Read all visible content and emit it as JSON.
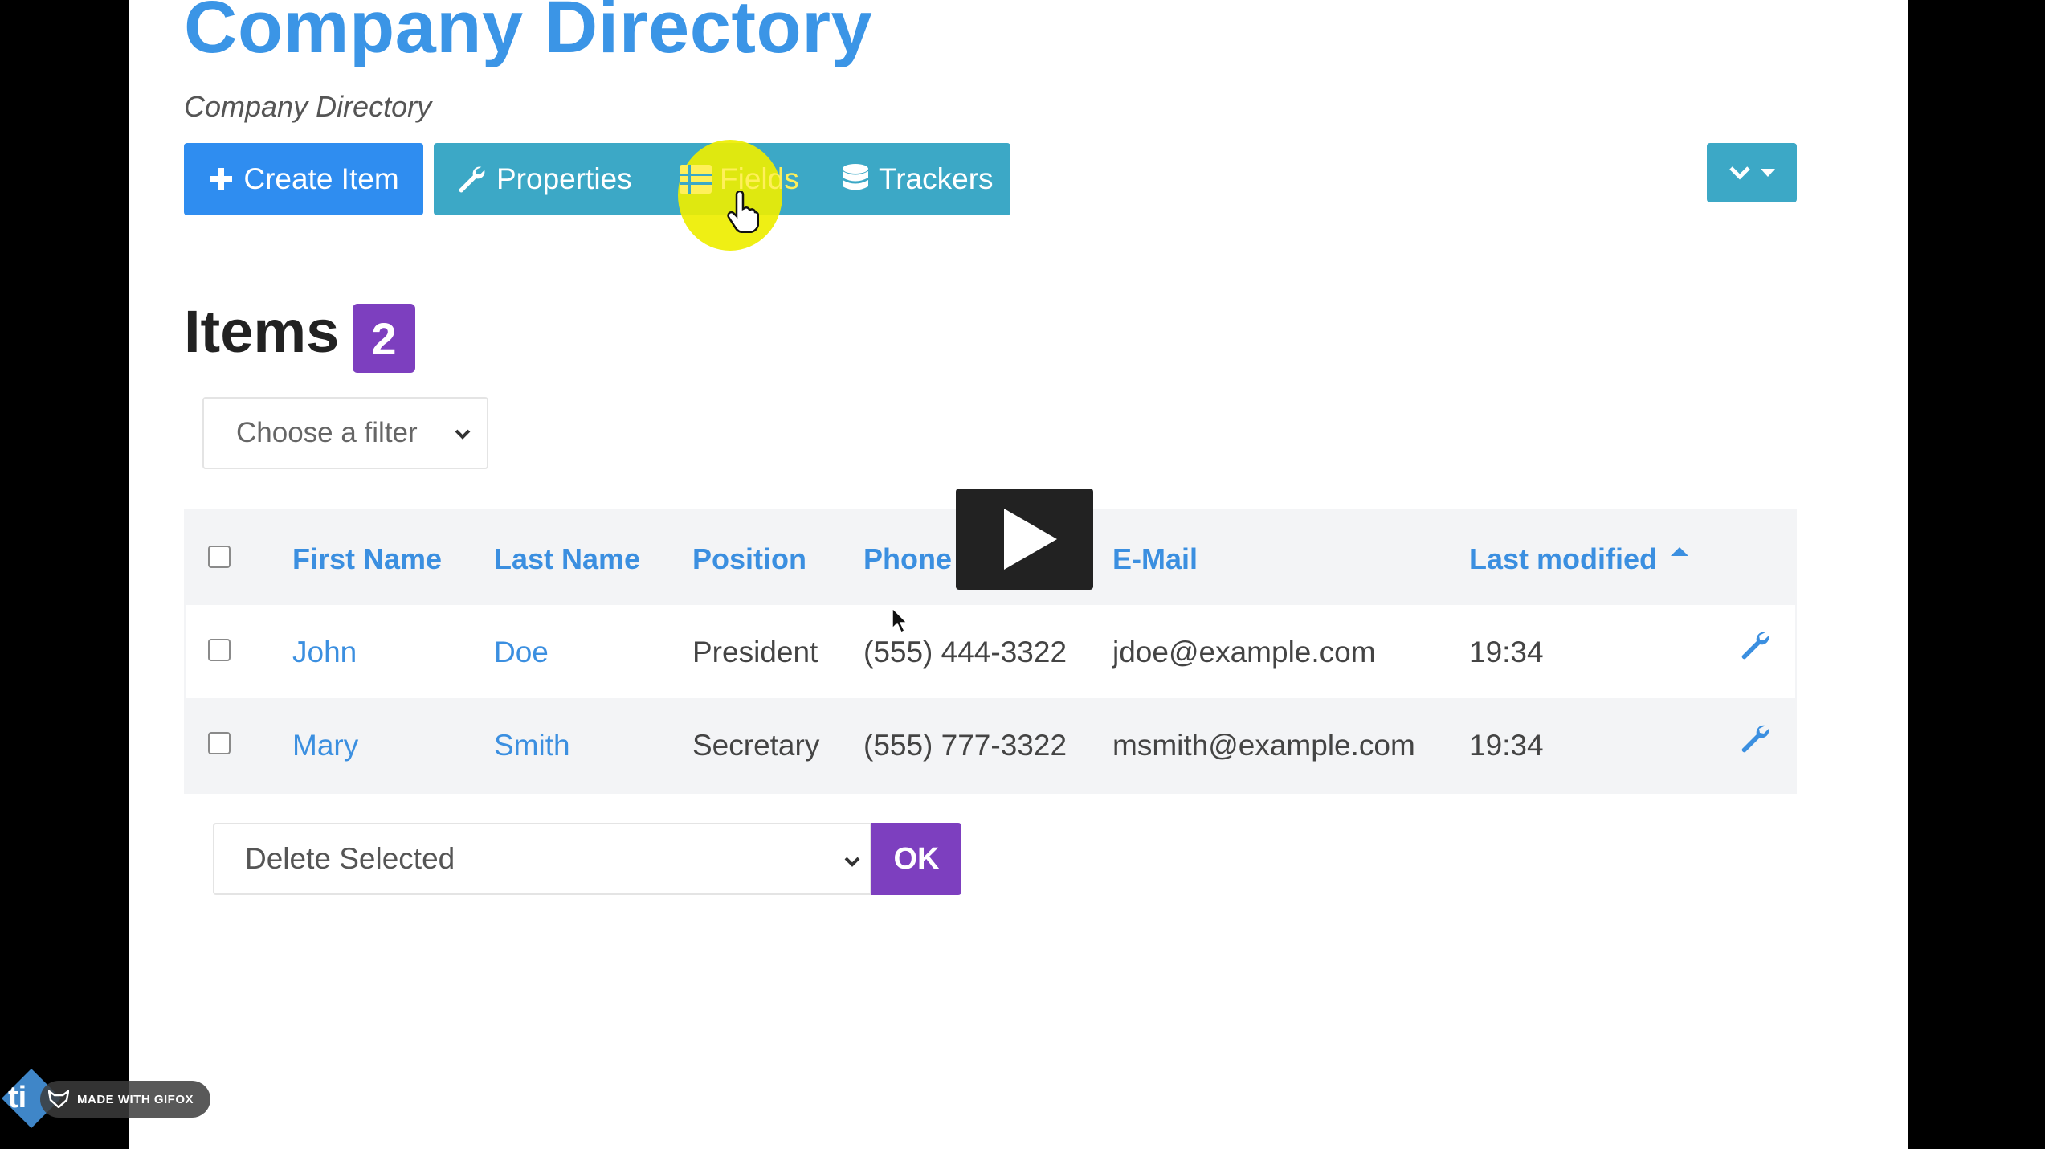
{
  "header": {
    "title": "Company Directory",
    "subtitle": "Company Directory"
  },
  "toolbar": {
    "create_label": "Create Item",
    "properties_label": "Properties",
    "fields_label": "Fields",
    "trackers_label": "Trackers"
  },
  "items": {
    "heading": "Items",
    "count": "2"
  },
  "filter": {
    "placeholder": "Choose a filter"
  },
  "table": {
    "columns": [
      "First Name",
      "Last Name",
      "Position",
      "Phone",
      "E-Mail",
      "Last modified"
    ],
    "sorted_column": "Last modified",
    "sort_direction": "ascending",
    "rows": [
      {
        "first": "John",
        "last": "Doe",
        "position": "President",
        "phone": "(555) 444-3322",
        "email": "jdoe@example.com",
        "modified": "19:34"
      },
      {
        "first": "Mary",
        "last": "Smith",
        "position": "Secretary",
        "phone": "(555) 777-3322",
        "email": "msmith@example.com",
        "modified": "19:34"
      }
    ]
  },
  "bulk_action": {
    "selected": "Delete Selected",
    "ok_label": "OK"
  },
  "overlay": {
    "watermark": "MADE WITH GIFOX"
  },
  "colors": {
    "link_blue": "#3b8fe0",
    "primary_blue": "#2f8df0",
    "info_teal": "#3ca8c6",
    "purple": "#7d3fbf",
    "highlight_yellow": "#eeee00"
  }
}
